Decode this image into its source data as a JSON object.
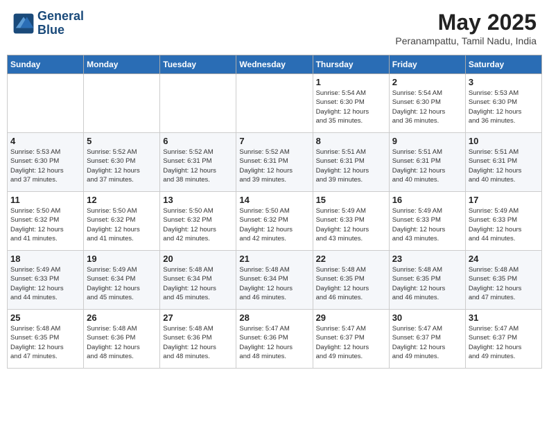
{
  "header": {
    "logo_line1": "General",
    "logo_line2": "Blue",
    "month": "May 2025",
    "location": "Peranampattu, Tamil Nadu, India"
  },
  "weekdays": [
    "Sunday",
    "Monday",
    "Tuesday",
    "Wednesday",
    "Thursday",
    "Friday",
    "Saturday"
  ],
  "weeks": [
    [
      {
        "day": "",
        "content": ""
      },
      {
        "day": "",
        "content": ""
      },
      {
        "day": "",
        "content": ""
      },
      {
        "day": "",
        "content": ""
      },
      {
        "day": "1",
        "content": "Sunrise: 5:54 AM\nSunset: 6:30 PM\nDaylight: 12 hours\nand 35 minutes."
      },
      {
        "day": "2",
        "content": "Sunrise: 5:54 AM\nSunset: 6:30 PM\nDaylight: 12 hours\nand 36 minutes."
      },
      {
        "day": "3",
        "content": "Sunrise: 5:53 AM\nSunset: 6:30 PM\nDaylight: 12 hours\nand 36 minutes."
      }
    ],
    [
      {
        "day": "4",
        "content": "Sunrise: 5:53 AM\nSunset: 6:30 PM\nDaylight: 12 hours\nand 37 minutes."
      },
      {
        "day": "5",
        "content": "Sunrise: 5:52 AM\nSunset: 6:30 PM\nDaylight: 12 hours\nand 37 minutes."
      },
      {
        "day": "6",
        "content": "Sunrise: 5:52 AM\nSunset: 6:31 PM\nDaylight: 12 hours\nand 38 minutes."
      },
      {
        "day": "7",
        "content": "Sunrise: 5:52 AM\nSunset: 6:31 PM\nDaylight: 12 hours\nand 39 minutes."
      },
      {
        "day": "8",
        "content": "Sunrise: 5:51 AM\nSunset: 6:31 PM\nDaylight: 12 hours\nand 39 minutes."
      },
      {
        "day": "9",
        "content": "Sunrise: 5:51 AM\nSunset: 6:31 PM\nDaylight: 12 hours\nand 40 minutes."
      },
      {
        "day": "10",
        "content": "Sunrise: 5:51 AM\nSunset: 6:31 PM\nDaylight: 12 hours\nand 40 minutes."
      }
    ],
    [
      {
        "day": "11",
        "content": "Sunrise: 5:50 AM\nSunset: 6:32 PM\nDaylight: 12 hours\nand 41 minutes."
      },
      {
        "day": "12",
        "content": "Sunrise: 5:50 AM\nSunset: 6:32 PM\nDaylight: 12 hours\nand 41 minutes."
      },
      {
        "day": "13",
        "content": "Sunrise: 5:50 AM\nSunset: 6:32 PM\nDaylight: 12 hours\nand 42 minutes."
      },
      {
        "day": "14",
        "content": "Sunrise: 5:50 AM\nSunset: 6:32 PM\nDaylight: 12 hours\nand 42 minutes."
      },
      {
        "day": "15",
        "content": "Sunrise: 5:49 AM\nSunset: 6:33 PM\nDaylight: 12 hours\nand 43 minutes."
      },
      {
        "day": "16",
        "content": "Sunrise: 5:49 AM\nSunset: 6:33 PM\nDaylight: 12 hours\nand 43 minutes."
      },
      {
        "day": "17",
        "content": "Sunrise: 5:49 AM\nSunset: 6:33 PM\nDaylight: 12 hours\nand 44 minutes."
      }
    ],
    [
      {
        "day": "18",
        "content": "Sunrise: 5:49 AM\nSunset: 6:33 PM\nDaylight: 12 hours\nand 44 minutes."
      },
      {
        "day": "19",
        "content": "Sunrise: 5:49 AM\nSunset: 6:34 PM\nDaylight: 12 hours\nand 45 minutes."
      },
      {
        "day": "20",
        "content": "Sunrise: 5:48 AM\nSunset: 6:34 PM\nDaylight: 12 hours\nand 45 minutes."
      },
      {
        "day": "21",
        "content": "Sunrise: 5:48 AM\nSunset: 6:34 PM\nDaylight: 12 hours\nand 46 minutes."
      },
      {
        "day": "22",
        "content": "Sunrise: 5:48 AM\nSunset: 6:35 PM\nDaylight: 12 hours\nand 46 minutes."
      },
      {
        "day": "23",
        "content": "Sunrise: 5:48 AM\nSunset: 6:35 PM\nDaylight: 12 hours\nand 46 minutes."
      },
      {
        "day": "24",
        "content": "Sunrise: 5:48 AM\nSunset: 6:35 PM\nDaylight: 12 hours\nand 47 minutes."
      }
    ],
    [
      {
        "day": "25",
        "content": "Sunrise: 5:48 AM\nSunset: 6:35 PM\nDaylight: 12 hours\nand 47 minutes."
      },
      {
        "day": "26",
        "content": "Sunrise: 5:48 AM\nSunset: 6:36 PM\nDaylight: 12 hours\nand 48 minutes."
      },
      {
        "day": "27",
        "content": "Sunrise: 5:48 AM\nSunset: 6:36 PM\nDaylight: 12 hours\nand 48 minutes."
      },
      {
        "day": "28",
        "content": "Sunrise: 5:47 AM\nSunset: 6:36 PM\nDaylight: 12 hours\nand 48 minutes."
      },
      {
        "day": "29",
        "content": "Sunrise: 5:47 AM\nSunset: 6:37 PM\nDaylight: 12 hours\nand 49 minutes."
      },
      {
        "day": "30",
        "content": "Sunrise: 5:47 AM\nSunset: 6:37 PM\nDaylight: 12 hours\nand 49 minutes."
      },
      {
        "day": "31",
        "content": "Sunrise: 5:47 AM\nSunset: 6:37 PM\nDaylight: 12 hours\nand 49 minutes."
      }
    ]
  ]
}
